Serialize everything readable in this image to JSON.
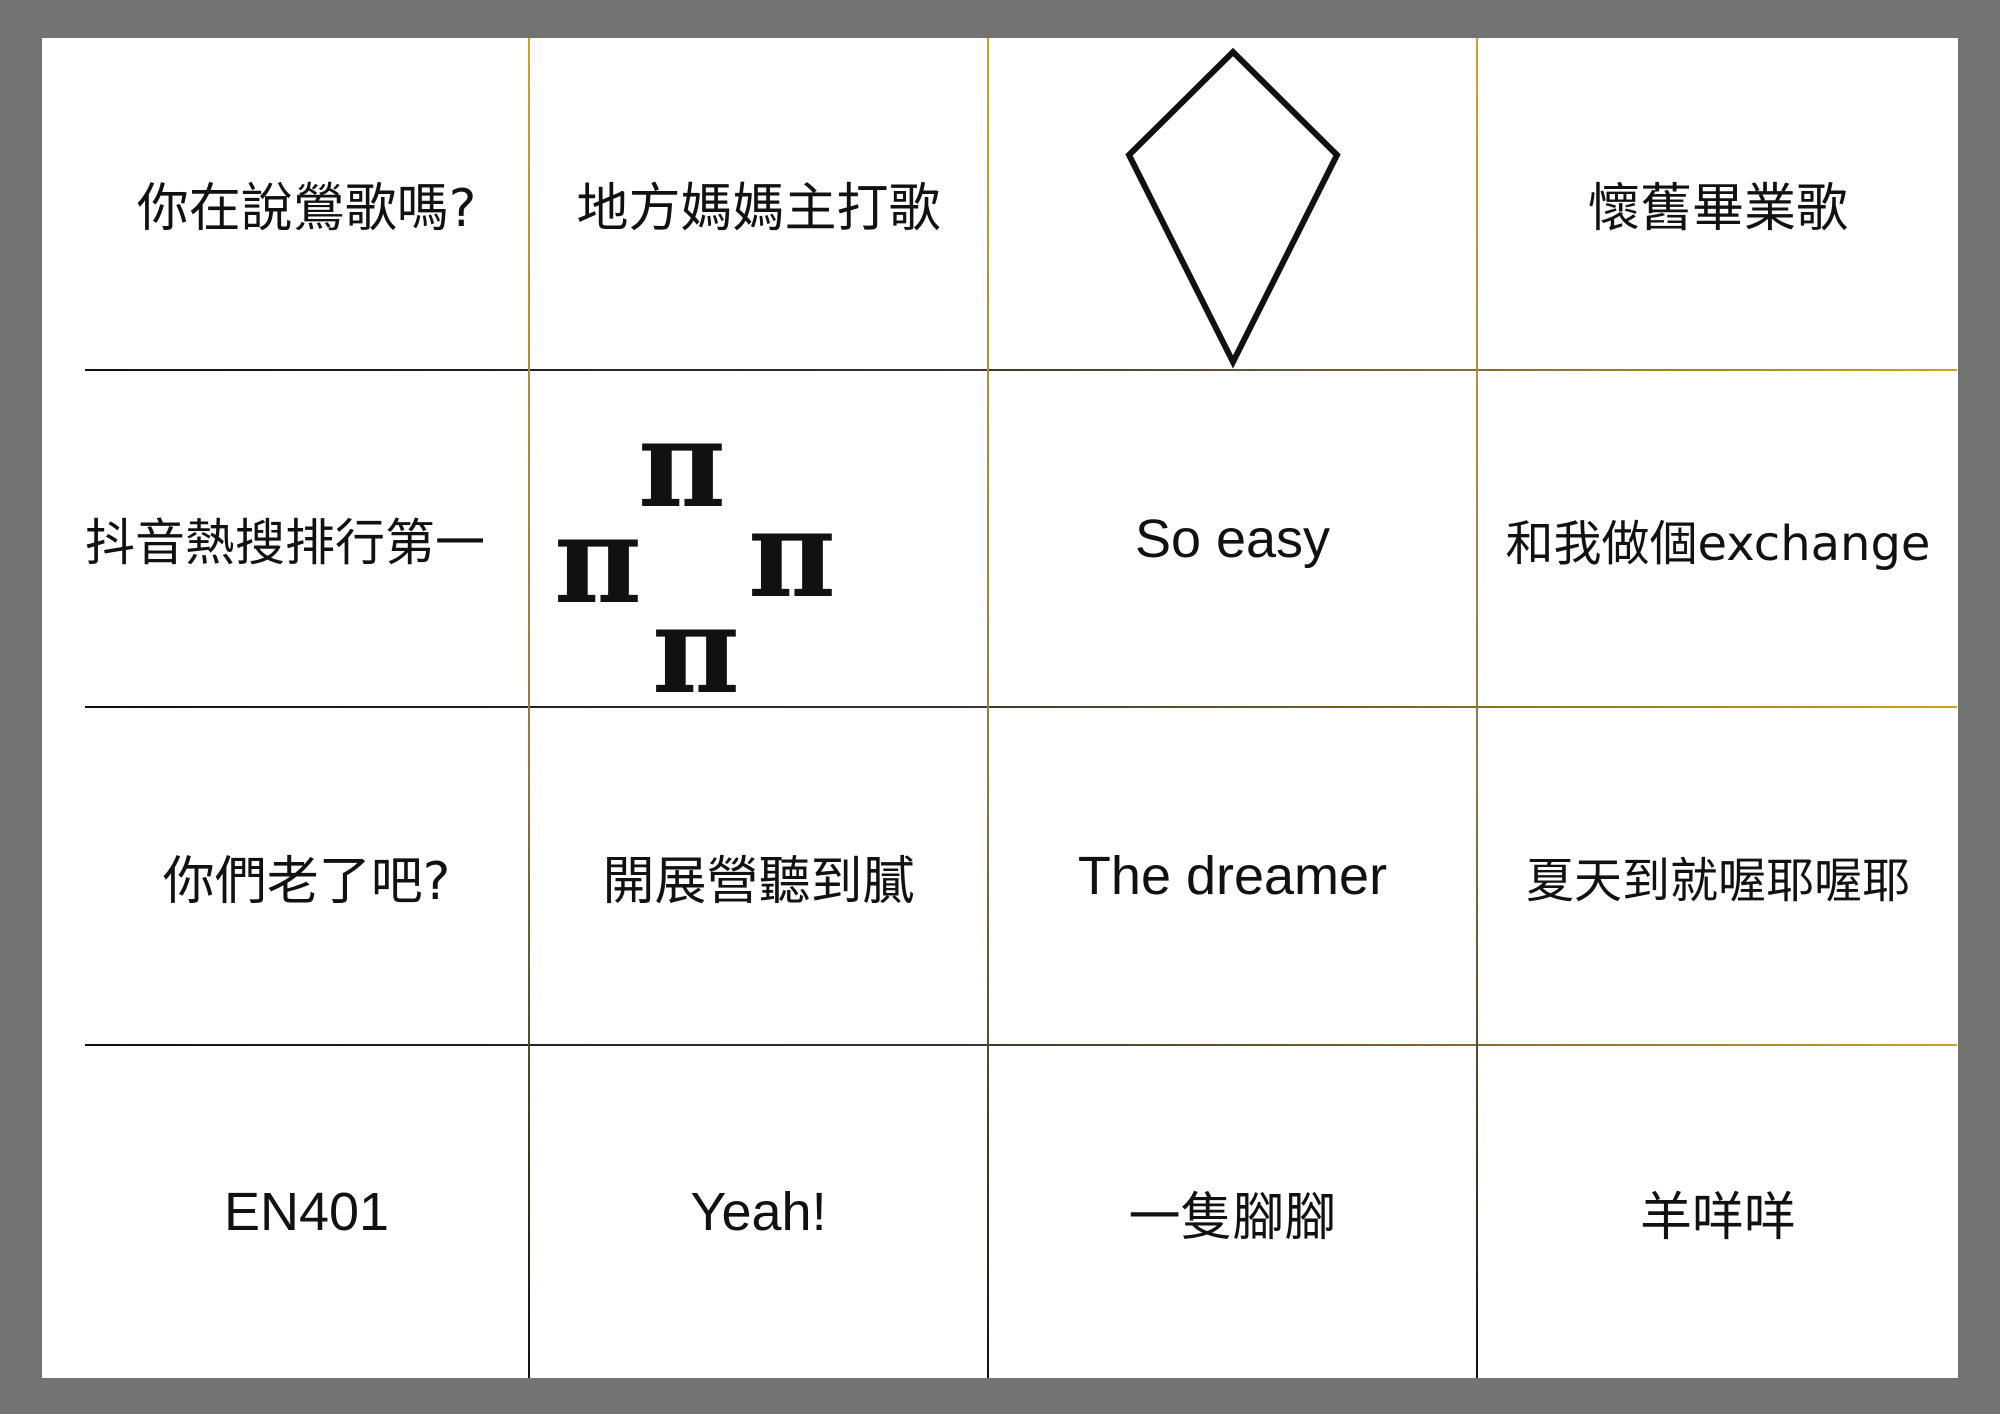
{
  "colors": {
    "frame": "#737373",
    "sheet": "#ffffff",
    "dark_line": "#1a1a1a",
    "gold_line": "#c9a227"
  },
  "cells": {
    "r1c1": "你在說鶯歌嗎?",
    "r1c2": "地方媽媽主打歌",
    "r1c3_icon": "kite-outline-icon",
    "r1c4": "懷舊畢業歌",
    "r2c1": "抖音熱搜排行第一",
    "r2c2_icon": "pi-symbols-icon",
    "r2c2_symbols": [
      "π",
      "π",
      "π",
      "π"
    ],
    "r2c3": "So easy",
    "r2c4": "和我做個exchange",
    "r3c1": "你們老了吧?",
    "r3c2": "開展營聽到膩",
    "r3c3": "The dreamer",
    "r3c4": "夏天到就喔耶喔耶",
    "r4c1": "EN401",
    "r4c2": "Yeah!",
    "r4c3": "一隻腳腳",
    "r4c4": "羊咩咩"
  }
}
